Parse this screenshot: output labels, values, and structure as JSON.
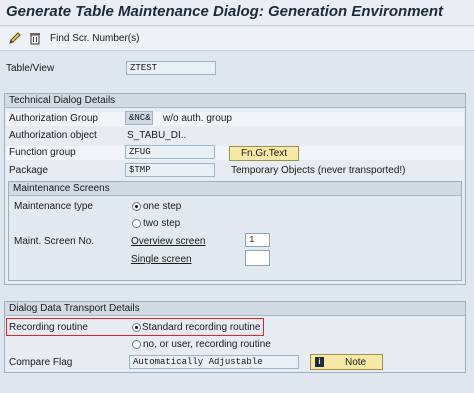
{
  "window": {
    "title": "Generate Table Maintenance Dialog: Generation Environment"
  },
  "toolbar": {
    "edit_icon": "pencil-icon",
    "delete_icon": "trash-icon",
    "find_label": "Find Scr. Number(s)"
  },
  "table_view": {
    "label": "Table/View",
    "value": "ZTEST"
  },
  "technical": {
    "title": "Technical Dialog Details",
    "auth_group_label": "Authorization Group",
    "auth_group_value": "&NC&",
    "auth_group_desc": "w/o auth. group",
    "auth_object_label": "Authorization object",
    "auth_object_value": "S_TABU_DI..",
    "function_group_label": "Function group",
    "function_group_value": "ZFUG",
    "fngr_button": "Fn.Gr.Text",
    "package_label": "Package",
    "package_value": "$TMP",
    "package_desc": "Temporary Objects (never transported!)"
  },
  "screens": {
    "title": "Maintenance Screens",
    "type_label": "Maint. type",
    "type_label_full": "Maintenance type",
    "one_step": "one step",
    "two_step": "two step",
    "screen_no_label": "Maint. Screen No.",
    "overview_label": "Overview screen",
    "overview_value": "1",
    "single_label": "Single screen",
    "single_value": ""
  },
  "transport": {
    "title": "Dialog Data Transport Details",
    "recording_label": "Recording routine",
    "standard_routine": "Standard recording routine",
    "no_user_routine": "no, or user, recording routine",
    "compare_label": "Compare Flag",
    "compare_value": "Automatically Adjustable",
    "note_button": "Note"
  }
}
